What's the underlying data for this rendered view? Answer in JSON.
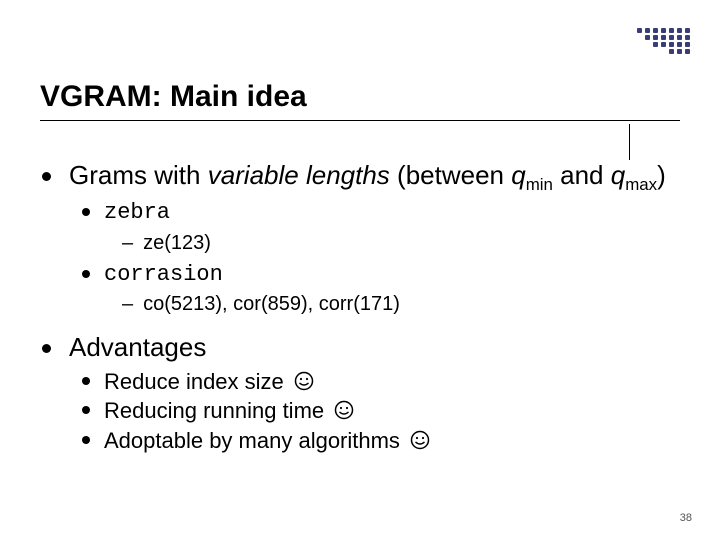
{
  "title": "VGRAM: Main idea",
  "bullets": [
    {
      "text_html": "Grams with <span class='italic'>variable lengths</span> (between <span class='italic'>q</span><sub>min</sub> and <span class='italic'>q</span><sub>max</sub>)",
      "children": [
        {
          "text": "zebra",
          "mono": true,
          "subitems": [
            "ze(123)"
          ]
        },
        {
          "text": "corrasion",
          "mono": true,
          "subitems": [
            "co(5213), cor(859), corr(171)"
          ]
        }
      ]
    },
    {
      "text_html": "Advantages",
      "children": [
        {
          "text": "Reduce index size",
          "smiley": true
        },
        {
          "text": "Reducing running time",
          "smiley": true
        },
        {
          "text": "Adoptable by many algorithms",
          "smiley": true
        }
      ]
    }
  ],
  "page_number": "38"
}
